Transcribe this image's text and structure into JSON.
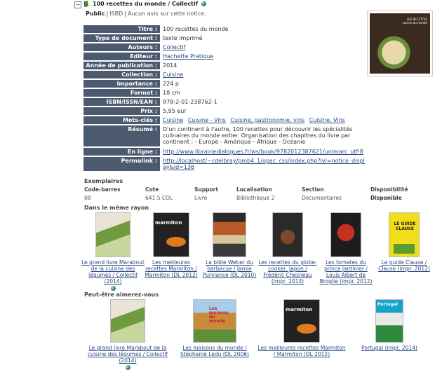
{
  "header": {
    "collapse_symbol": "−",
    "title": "100 recettes du monde / Collectif",
    "tabs": [
      "Public",
      "ISBD",
      "Aucun avis sur cette notice."
    ]
  },
  "notice": [
    {
      "label": "Titre :",
      "value": "100 recettes du monde",
      "link": false
    },
    {
      "label": "Type de document :",
      "value": "texte imprimé",
      "link": false
    },
    {
      "label": "Auteurs :",
      "value": "Collectif",
      "link": true
    },
    {
      "label": "Editeur :",
      "value": "Hachette Pratique",
      "link": true
    },
    {
      "label": "Année de publication :",
      "value": "2014",
      "link": false
    },
    {
      "label": "Collection :",
      "value": "Cuisine",
      "link": true
    },
    {
      "label": "Importance :",
      "value": "224 p",
      "link": false
    },
    {
      "label": "Format :",
      "value": "18 cm",
      "link": false
    },
    {
      "label": "ISBN/ISSN/EAN :",
      "value": "978-2-01-238762-1",
      "link": false
    },
    {
      "label": "Prix :",
      "value": "5,95 eur",
      "link": false
    }
  ],
  "keywords": {
    "label": "Mots-clés :",
    "items": [
      "Cuisine",
      "Cuisine - Vins",
      "Cuisine, gastronomie, vins",
      "Cuisine, Vins"
    ]
  },
  "resume": {
    "label": "Résumé :",
    "value": "D'un continent à l'autre, 100 recettes pour découvrir les spécialités culinaires du monde entier. Organisation des chapitres du livre par continent : - Europe - Amérique - Afrique - Océanie"
  },
  "online": {
    "label": "En ligne :",
    "value": "http://www.librairiedialogues.fr/ws/book/9782012387621/unimarc_utf-8"
  },
  "permalink": {
    "label": "Permalink :",
    "value": "http://localhost/~cdelbray/pmb4_1/opac_css/index.php?lvl=notice_display&id=136"
  },
  "exemplaires": {
    "title": "Exemplaires",
    "headers": [
      "Code-barres",
      "Cote",
      "Support",
      "Localisation",
      "Section",
      "Disponibilité"
    ],
    "row": [
      "08",
      "641.5 COL",
      "Livre",
      "Bibliothèque 2",
      "Documentaires",
      "Disponible"
    ]
  },
  "same_shelf": {
    "title": "Dans le même rayon",
    "items": [
      {
        "caption": "Le grand livre Marabout de la cuisine des légumes / Collectif (2014)",
        "globe": true
      },
      {
        "caption": "Les meilleures recettes Marmiton / Marmiton (DL 2012)",
        "globe": false
      },
      {
        "caption": "La bible Weber du barbecue / Jamie Purviance (DL 2010)",
        "globe": false
      },
      {
        "caption": "Les recettes du globe-cooker, Japon / Frédéric Chesneau (impr. 2013)",
        "globe": false
      },
      {
        "caption": "Les tomates du prince jardinier / Louis Albert de Broglie (impr. 2012)",
        "globe": false
      },
      {
        "caption": "Le guide Clause / Clause (impr. 2012)",
        "globe": false
      }
    ]
  },
  "suggestions": {
    "title": "Peut-être aimerez-vous",
    "items": [
      {
        "caption": "Le grand livre Marabout de la cuisine des légumes / Collectif (2014)",
        "globe": true
      },
      {
        "caption": "Les maisons du monde / Stéphanie Ledu (DL 2006)",
        "globe": false
      },
      {
        "caption": "Les meilleures recettes Marmiton / Marmiton (DL 2012)",
        "globe": false
      },
      {
        "caption": "Portugal (impr. 2014)",
        "globe": false
      }
    ]
  },
  "cover_badge": "LES RECETTES cuisine du monde",
  "cover_texts": {
    "marmiton": "marmiton",
    "clause": "LE GUIDE CLAUSE",
    "portugal": "Portugal",
    "maisons": "Les maisons du monde"
  },
  "colors": {
    "label_bg": "#4b5a6e",
    "link": "#2a4a7f"
  }
}
